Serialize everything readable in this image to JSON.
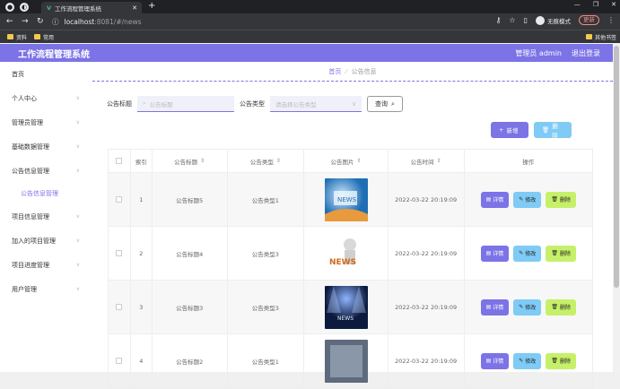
{
  "browser": {
    "tab_title": "工作流程管理系统",
    "url_host": "localhost",
    "url_rest": ":8081/#/news",
    "profile": "无痕模式",
    "update": "更新",
    "bookmarks": [
      "资料",
      "常用"
    ],
    "bookmark_right": "其他书签"
  },
  "header": {
    "brand": "工作流程管理系统",
    "user": "管理员 admin",
    "logout": "退出登录"
  },
  "sidebar": {
    "items": [
      "首页",
      "个人中心",
      "管理员管理",
      "基础数据管理",
      "公告信息管理",
      "项目信息管理",
      "加入的项目管理",
      "项目进度管理",
      "用户管理"
    ],
    "sub_item": "公告信息管理"
  },
  "breadcrumb": {
    "home": "首页",
    "current": "公告信息"
  },
  "search": {
    "title_label": "公告标题",
    "title_placeholder": "公告标题",
    "type_label": "公告类型",
    "type_placeholder": "请选择公告类型",
    "query": "查询"
  },
  "actions": {
    "add": "新增",
    "delete": "删除"
  },
  "table": {
    "headers": [
      "索引",
      "公告标题",
      "公告类型",
      "公告图片",
      "公告时间",
      "操作"
    ],
    "rows": [
      {
        "index": "1",
        "title": "公告标题5",
        "type": "公告类型1",
        "time": "2022-03-22 20:19:09"
      },
      {
        "index": "2",
        "title": "公告标题4",
        "type": "公告类型3",
        "time": "2022-03-22 20:19:09"
      },
      {
        "index": "3",
        "title": "公告标题3",
        "type": "公告类型3",
        "time": "2022-03-22 20:19:09"
      },
      {
        "index": "4",
        "title": "公告标题2",
        "type": "公告类型1",
        "time": "2022-03-22 20:19:09"
      }
    ],
    "op_detail": "详情",
    "op_edit": "修改",
    "op_delete": "删除",
    "image_texts": [
      "NEWS",
      "NEWS",
      "NEWS"
    ]
  },
  "colors": {
    "accent": "#7c73e6",
    "info": "#7fcbf5",
    "danger": "#c7f06a"
  }
}
